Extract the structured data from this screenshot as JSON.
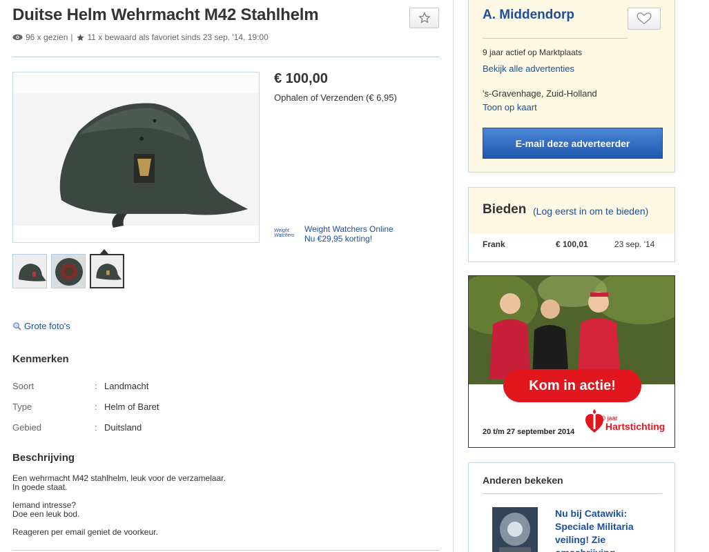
{
  "listing": {
    "title": "Duitse Helm Wehrmacht M42 Stahlhelm",
    "views": "96 x gezien",
    "separator": "|",
    "favorites": "11 x bewaard als favoriet sinds 23 sep. '14, 19:00",
    "price": "€ 100,00",
    "shipping": "Ophalen of Verzenden (€ 6,95)",
    "large_photos_link": "Grote foto's"
  },
  "ad_small": {
    "logo": "Weight Watchers",
    "line1": "Weight Watchers Online",
    "line2": "Nu €29,95 korting!"
  },
  "characteristics": {
    "heading": "Kenmerken",
    "separator": ":",
    "rows": [
      {
        "key": "Soort",
        "value": "Landmacht"
      },
      {
        "key": "Type",
        "value": "Helm of Baret"
      },
      {
        "key": "Gebied",
        "value": "Duitsland"
      }
    ]
  },
  "description": {
    "heading": "Beschrijving",
    "lines": [
      "Een wehrmacht M42 stahlhelm, leuk voor de verzamelaar.",
      "In goede staat.",
      "Iemand intresse?",
      "Doe een leuk bod.",
      "Reageren per email geniet de voorkeur."
    ]
  },
  "seller": {
    "name": "A. Middendorp",
    "active": "9 jaar actief op Marktplaats",
    "all_ads_link": "Bekijk alle advertenties",
    "location": "'s-Gravenhage, Zuid-Holland",
    "map_link": "Toon op kaart",
    "email_button": "E-mail deze adverteerder"
  },
  "bidding": {
    "title": "Bieden",
    "login_note": "(Log eerst in om te bieden)",
    "bids": [
      {
        "name": "Frank",
        "amount": "€ 100,01",
        "date": "23 sep. '14"
      }
    ]
  },
  "banner": {
    "cta": "Kom in actie!",
    "date": "20 t/m 27 september 2014",
    "brand": "Hartstichting",
    "years": "50 jaar"
  },
  "others": {
    "title": "Anderen bekeken",
    "item_text": "Nu bij Catawiki: Speciale Militaria veiling! Zie omschrijving"
  },
  "colors": {
    "link": "#1d4e9b",
    "highlight_bg": "#fdf8e3",
    "button_blue": "#1f57ad",
    "banner_red": "#e2171e"
  }
}
